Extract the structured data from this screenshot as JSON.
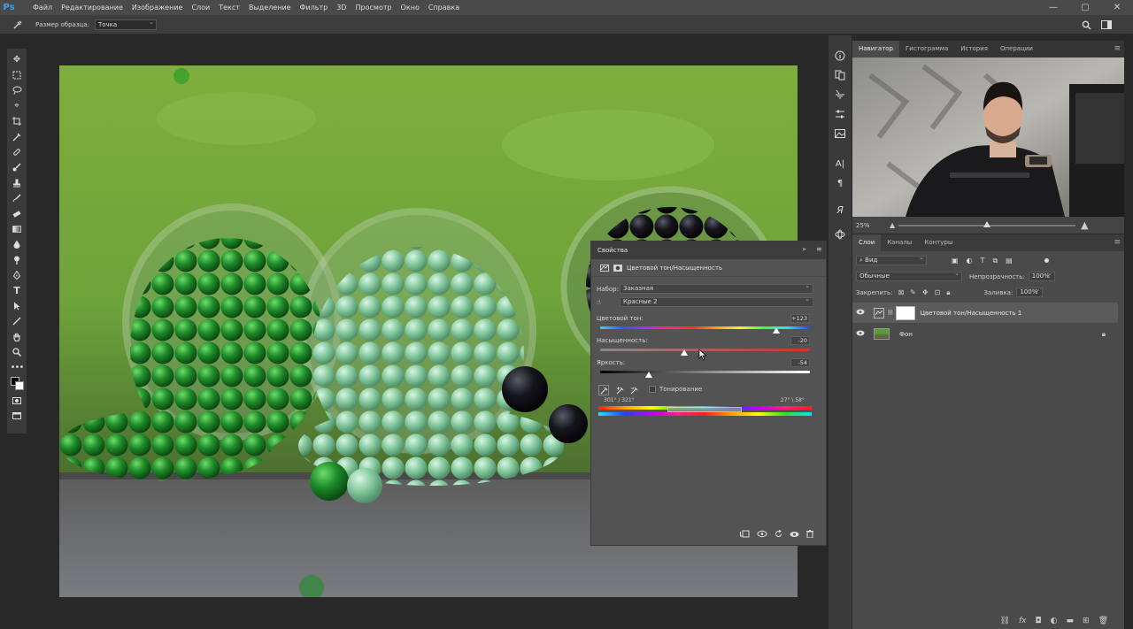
{
  "app": {
    "logo": "Ps",
    "menu": [
      "Файл",
      "Редактирование",
      "Изображение",
      "Слои",
      "Текст",
      "Выделение",
      "Фильтр",
      "3D",
      "Просмотр",
      "Окно",
      "Справка"
    ],
    "window_controls": {
      "minimize": "—",
      "maximize": "▢",
      "close": "✕"
    }
  },
  "options_bar": {
    "tool_icon": "eyedropper-icon",
    "sample_size_label": "Размер образца:",
    "sample_size_value": "Точка"
  },
  "toolbar": {
    "tools": [
      "move-tool",
      "marquee-tool",
      "lasso-tool",
      "quick-select-tool",
      "crop-tool",
      "eyedropper-tool",
      "healing-tool",
      "brush-tool",
      "clone-stamp-tool",
      "history-brush-tool",
      "eraser-tool",
      "gradient-tool",
      "blur-tool",
      "dodge-tool",
      "pen-tool",
      "type-tool",
      "path-select-tool",
      "line-tool",
      "hand-tool",
      "zoom-tool",
      "more-tools"
    ]
  },
  "properties": {
    "tab": "Свойства",
    "header_title": "Цветовой тон/Насыщенность",
    "preset_label": "Набор:",
    "preset_value": "Заказная",
    "channel_value": "Красные 2",
    "hue_label": "Цветовой тон:",
    "hue_value": "+123",
    "saturation_label": "Насыщенность:",
    "saturation_value": "-20",
    "lightness_label": "Яркость:",
    "lightness_value": "-54",
    "hue_fraction": 0.84,
    "saturation_fraction": 0.4,
    "lightness_fraction": 0.23,
    "colorize_label": "Тонирование",
    "range_left": "301° / 321°",
    "range_right": "27° \\ 58°"
  },
  "navigator": {
    "tabs": [
      "Навигатор",
      "Гистограмма",
      "История",
      "Операции"
    ],
    "zoom": "25%",
    "zoom_fraction": 0.5
  },
  "layers": {
    "tabs": [
      "Слои",
      "Каналы",
      "Контуры"
    ],
    "filter_value": "Вид",
    "blend_mode": "Обычные",
    "opacity_label": "Непрозрачность:",
    "opacity_value": "100%",
    "lock_label": "Закрепить:",
    "fill_label": "Заливка:",
    "fill_value": "100%",
    "items": [
      {
        "name": "Цветовой тон/Насыщенность 1"
      },
      {
        "name": "Фон"
      }
    ]
  },
  "colors": {
    "accent": "#38a4f2",
    "panel": "#535353",
    "chrome": "#3a3a3a"
  }
}
